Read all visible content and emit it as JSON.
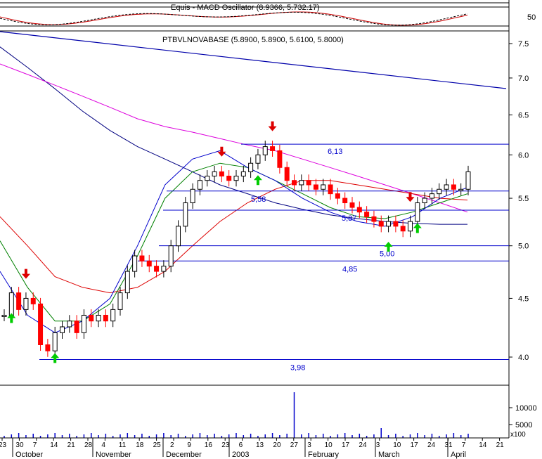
{
  "chart_data": {
    "type": "candlestick",
    "title": "PTBVLNOVABASE (5.8900, 5.8900, 5.6100, 5.8000)",
    "oscillator_header": "Equis - MACD Oscillator (8.9366, 5.732.17)",
    "y_price_ticks": [
      "7.5",
      "7.0",
      "6.5",
      "6.0",
      "5.5",
      "5.0",
      "4.5",
      "4.0"
    ],
    "y_osc_tick": "50",
    "y_volume_ticks": [
      "10000",
      "5000"
    ],
    "y_volume_unit": "x100",
    "x_day_ticks": [
      "23",
      "30",
      "7",
      "14",
      "21",
      "28",
      "4",
      "11",
      "18",
      "25",
      "2",
      "9",
      "16",
      "23",
      "6",
      "13",
      "20",
      "27",
      "3",
      "10",
      "17",
      "24",
      "3",
      "10",
      "17",
      "24",
      "31",
      "7",
      "14",
      "21"
    ],
    "x_month_labels": [
      "October",
      "November",
      "December",
      "2003",
      "February",
      "March",
      "April"
    ],
    "horizontal_levels": [
      {
        "value": 6.13,
        "label": "6,13"
      },
      {
        "value": 5.58,
        "label": "5,58"
      },
      {
        "value": 5.37,
        "label": "5,37"
      },
      {
        "value": 5.0,
        "label": "5,00"
      },
      {
        "value": 4.85,
        "label": "4,85"
      },
      {
        "value": 3.98,
        "label": "3,98"
      }
    ],
    "series": [
      {
        "color": "#000080",
        "values": [
          7.45,
          7.15,
          6.85,
          6.55,
          6.3,
          6.1,
          5.95,
          5.8,
          5.65,
          5.55,
          5.45,
          5.38,
          5.32,
          5.28,
          5.25,
          5.23,
          5.22,
          5.22
        ]
      },
      {
        "color": "#dd00dd",
        "values": [
          7.2,
          7.05,
          6.9,
          6.75,
          6.6,
          6.45,
          6.35,
          6.28,
          6.2,
          6.12,
          6.05,
          5.95,
          5.85,
          5.75,
          5.65,
          5.55,
          5.45,
          5.35
        ]
      },
      {
        "color": "#dd0000",
        "values": [
          5.3,
          5.0,
          4.7,
          4.6,
          4.55,
          4.6,
          4.75,
          5.0,
          5.25,
          5.45,
          5.6,
          5.7,
          5.7,
          5.65,
          5.6,
          5.55,
          5.5,
          5.48
        ]
      },
      {
        "color": "#008000",
        "values": [
          5.05,
          4.6,
          4.3,
          4.3,
          4.45,
          4.9,
          5.5,
          5.8,
          5.9,
          5.85,
          5.7,
          5.55,
          5.4,
          5.3,
          5.28,
          5.35,
          5.45,
          5.55
        ]
      },
      {
        "color": "#0000cc",
        "values": [
          4.75,
          4.35,
          4.2,
          4.3,
          4.5,
          5.0,
          5.65,
          5.95,
          6.05,
          5.85,
          5.7,
          5.5,
          5.35,
          5.25,
          5.2,
          5.3,
          5.5,
          5.62
        ]
      }
    ],
    "candles": [
      4.35,
      4.55,
      4.4,
      4.5,
      4.45,
      4.1,
      4.05,
      4.2,
      4.25,
      4.3,
      4.2,
      4.35,
      4.3,
      4.35,
      4.3,
      4.4,
      4.55,
      4.75,
      4.9,
      4.85,
      4.8,
      4.75,
      4.8,
      5.0,
      5.2,
      5.45,
      5.6,
      5.7,
      5.75,
      5.8,
      5.75,
      5.7,
      5.75,
      5.8,
      5.9,
      6.0,
      6.1,
      6.05,
      5.85,
      5.7,
      5.65,
      5.7,
      5.65,
      5.6,
      5.65,
      5.55,
      5.5,
      5.45,
      5.4,
      5.35,
      5.3,
      5.25,
      5.2,
      5.25,
      5.2,
      5.15,
      5.25,
      5.45,
      5.5,
      5.55,
      5.6,
      5.65,
      5.6,
      5.6,
      5.8
    ],
    "signals": [
      {
        "type": "sell",
        "idx": 3
      },
      {
        "type": "buy",
        "idx": 1
      },
      {
        "type": "buy",
        "idx": 7
      },
      {
        "type": "sell",
        "idx": 30
      },
      {
        "type": "buy",
        "idx": 35
      },
      {
        "type": "sell",
        "idx": 37
      },
      {
        "type": "buy",
        "idx": 53
      },
      {
        "type": "sell",
        "idx": 56
      },
      {
        "type": "buy",
        "idx": 57
      }
    ]
  },
  "colors": {
    "level_line": "#0000cc",
    "long_trend_line": "#0000aa",
    "up_candle": "#000000",
    "down_candle": "#ff0000",
    "buy_arrow": "#00cc00",
    "sell_arrow": "#dd0000",
    "volume": "#0000cc"
  }
}
